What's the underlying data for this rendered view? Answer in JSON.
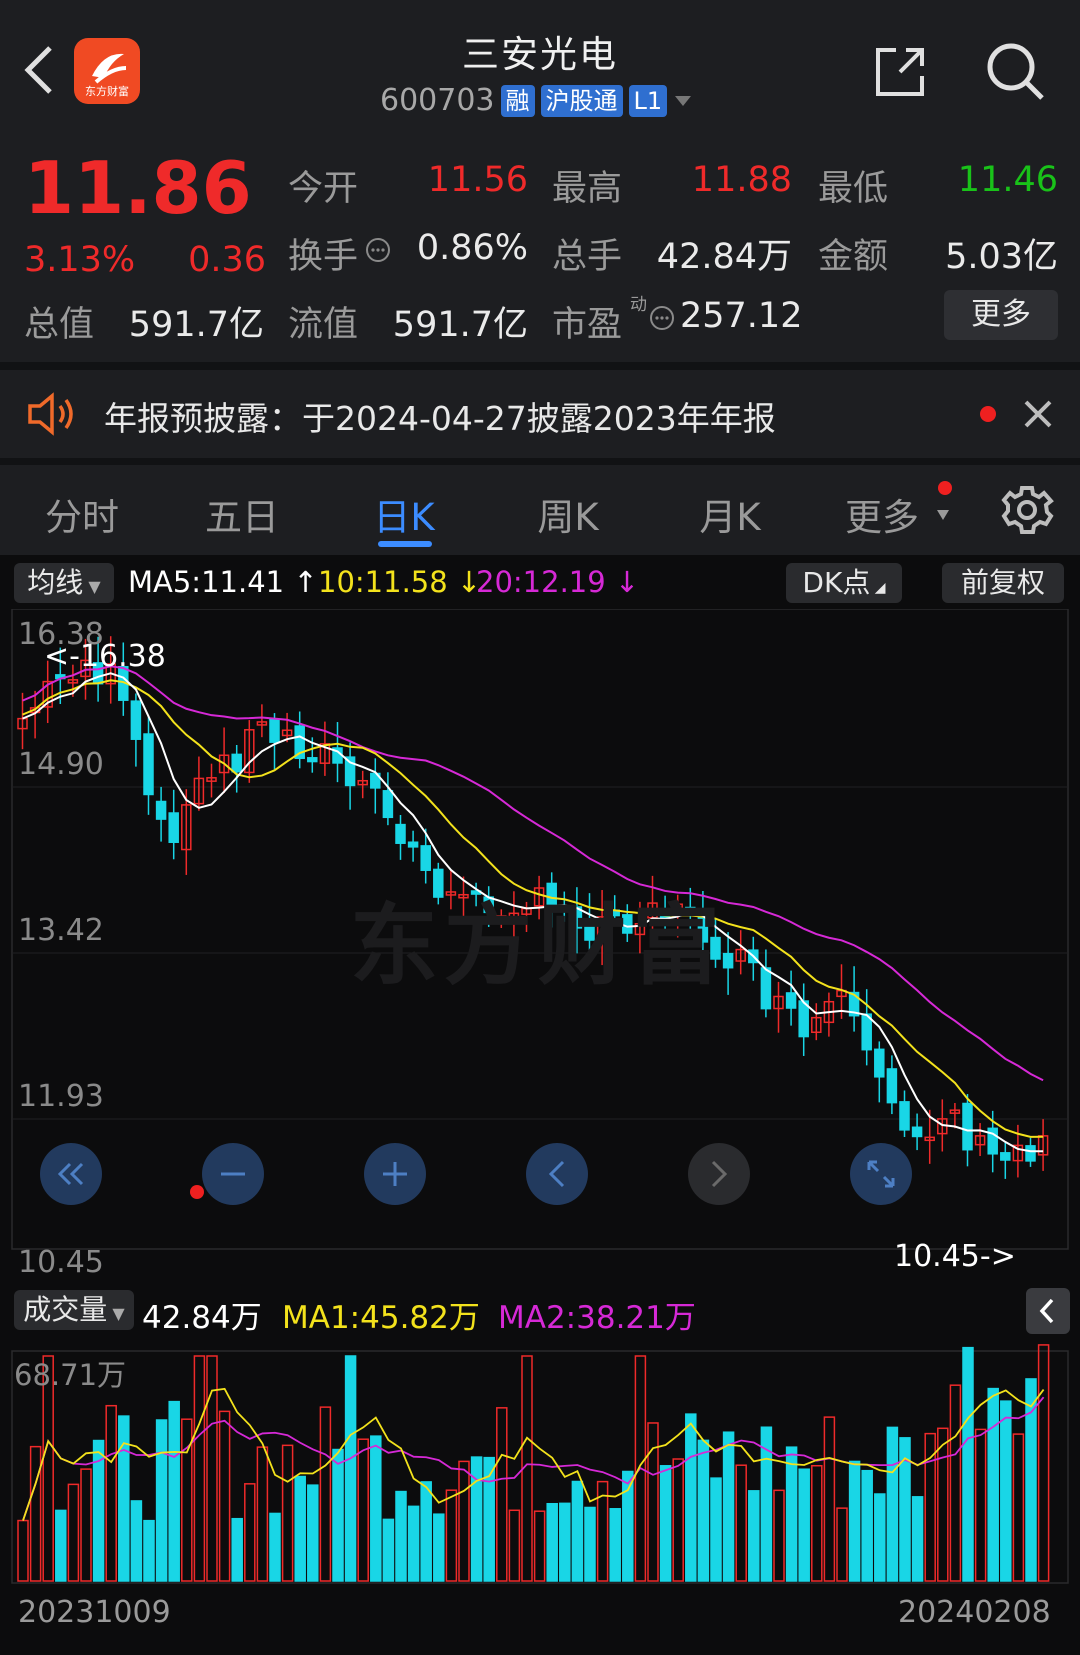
{
  "header": {
    "title": "三安光电",
    "code": "600703",
    "tags": [
      "融",
      "沪股通",
      "L1"
    ]
  },
  "quote": {
    "price": "11.86",
    "change_pct": "3.13%",
    "change": "0.36",
    "open_label": "今开",
    "open": "11.56",
    "high_label": "最高",
    "high": "11.88",
    "low_label": "最低",
    "low": "11.46",
    "turnover_label": "换手",
    "turnover": "0.86%",
    "volume_label": "总手",
    "volume": "42.84万",
    "amount_label": "金额",
    "amount": "5.03亿",
    "mktcap_label": "总值",
    "mktcap": "591.7亿",
    "float_label": "流值",
    "float": "591.7亿",
    "pe_label": "市盈",
    "pe_sup": "动",
    "pe": "257.12",
    "more": "更多"
  },
  "notice": {
    "text": "年报预披露：于2024-04-27披露2023年年报"
  },
  "tabs": [
    "分时",
    "五日",
    "日K",
    "周K",
    "月K",
    "更多"
  ],
  "active_tab": "日K",
  "ma_bar": {
    "selector": "均线",
    "ma5": "MA5:11.41",
    "ma10": "10:11.58",
    "ma20": "20:12.19",
    "dk": "DK点",
    "adj": "前复权"
  },
  "price_axis": [
    "16.38",
    "14.90",
    "13.42",
    "11.93",
    "10.45"
  ],
  "annotations": {
    "max": "<-16.38",
    "min": "10.45->"
  },
  "volume_bar": {
    "selector": "成交量",
    "vol": "42.84万",
    "ma1": "MA1:45.82万",
    "ma2": "MA2:38.21万",
    "max_label": "68.71万"
  },
  "dates": {
    "start": "20231009",
    "end": "20240208"
  },
  "watermark": "东方财富",
  "logo_text": "东方财富",
  "colors": {
    "up": "#ef2a2a",
    "down": "#19d6e6",
    "ma5": "#ffffff",
    "ma10": "#f3e21c",
    "ma20": "#d629d6"
  }
}
